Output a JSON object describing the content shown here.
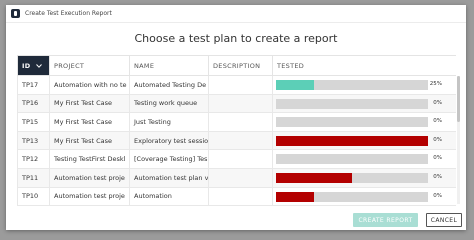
{
  "window": {
    "title": "Create Test Execution Report"
  },
  "heading": "Choose a test plan to create a report",
  "table": {
    "columns": {
      "id": "ID",
      "project": "PROJECT",
      "name": "NAME",
      "description": "DESCRIPTION",
      "tested": "TESTED"
    },
    "rows": [
      {
        "id": "TP17",
        "project": "Automation with no te",
        "name": "Automated Testing De",
        "description": "",
        "pct": "25%",
        "progress": 0.25,
        "color": "#5ccfb7"
      },
      {
        "id": "TP16",
        "project": "My First Test Case",
        "name": "Testing work queue",
        "description": "",
        "pct": "0%",
        "progress": 0,
        "color": "#d6d6d6"
      },
      {
        "id": "TP15",
        "project": "My First Test Case",
        "name": "Just Testing",
        "description": "",
        "pct": "0%",
        "progress": 0,
        "color": "#d6d6d6"
      },
      {
        "id": "TP13",
        "project": "My First Test Case",
        "name": "Exploratory test sessio",
        "description": "",
        "pct": "0%",
        "progress": 1.0,
        "color": "#b30000"
      },
      {
        "id": "TP12",
        "project": "Testing TestFirst Deskl",
        "name": "[Coverage Testing] Tes",
        "description": "",
        "pct": "0%",
        "progress": 0,
        "color": "#d6d6d6"
      },
      {
        "id": "TP11",
        "project": "Automation test proje",
        "name": "Automation test plan v",
        "description": "",
        "pct": "0%",
        "progress": 0.5,
        "color": "#b30000"
      },
      {
        "id": "TP10",
        "project": "Automation test proje",
        "name": "Automation",
        "description": "",
        "pct": "0%",
        "progress": 0.25,
        "color": "#b30000"
      }
    ]
  },
  "buttons": {
    "create": "CREATE REPORT",
    "cancel": "CANCEL"
  },
  "colors": {
    "header_active": "#1f2a3a",
    "progress_passed": "#5ccfb7",
    "progress_failed": "#b30000",
    "progress_track": "#d6d6d6",
    "create_disabled": "#a9ded4"
  }
}
